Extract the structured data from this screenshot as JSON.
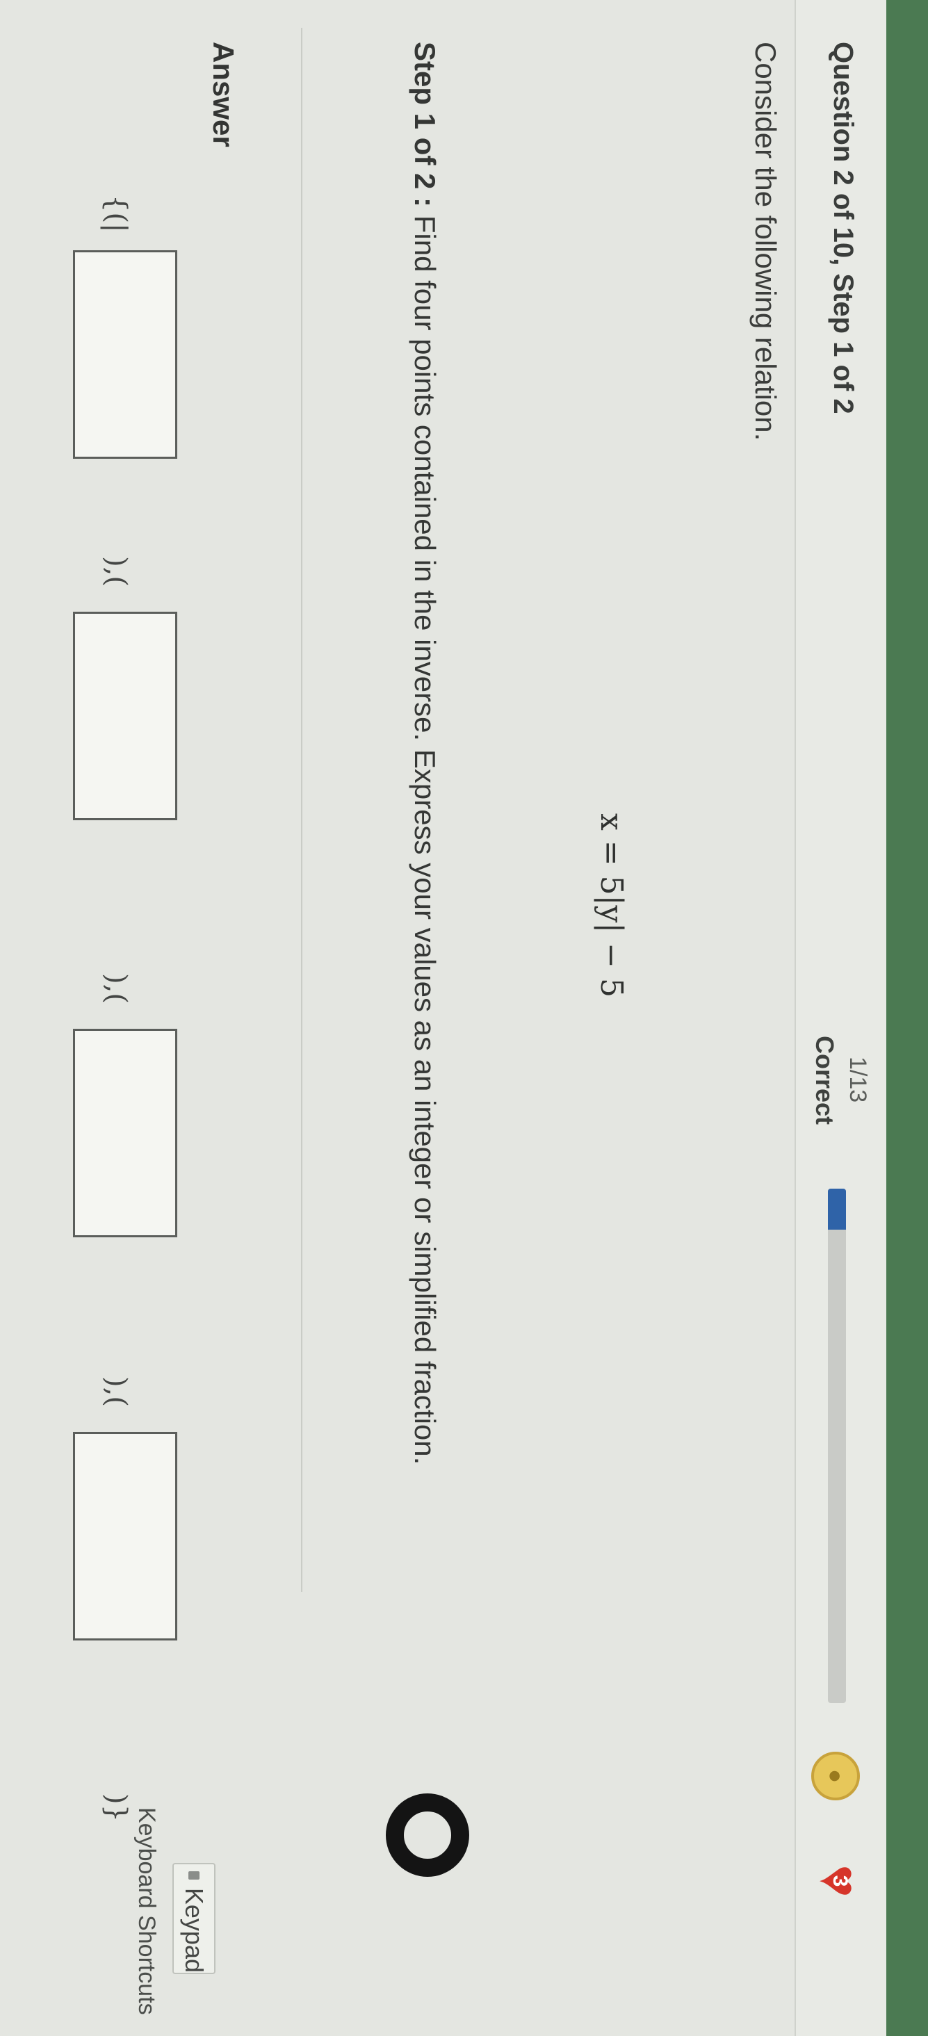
{
  "header": {
    "question_title": "Question 2 of 10, Step 1 of 2",
    "score_fraction": "1/13",
    "score_status": "Correct",
    "progress_fraction": 0.08,
    "heart_count": "3"
  },
  "question": {
    "prompt": "Consider the following relation.",
    "equation": "x = 5|y| − 5",
    "step_label": "Step 1 of 2 :",
    "step_instruction": "Find four points contained in the inverse. Express your values as an integer or simplified fraction."
  },
  "answer": {
    "label": "Answer",
    "open": "{(|",
    "sep1": "),(",
    "sep2": "),(",
    "sep3": "),(",
    "close": ")}"
  },
  "tools": {
    "keypad_label": "Keypad",
    "shortcuts_label": "Keyboard Shortcuts"
  },
  "colors": {
    "accent_green": "#4b7a52",
    "progress_blue": "#2f63a8",
    "heart_red": "#d6352a"
  }
}
